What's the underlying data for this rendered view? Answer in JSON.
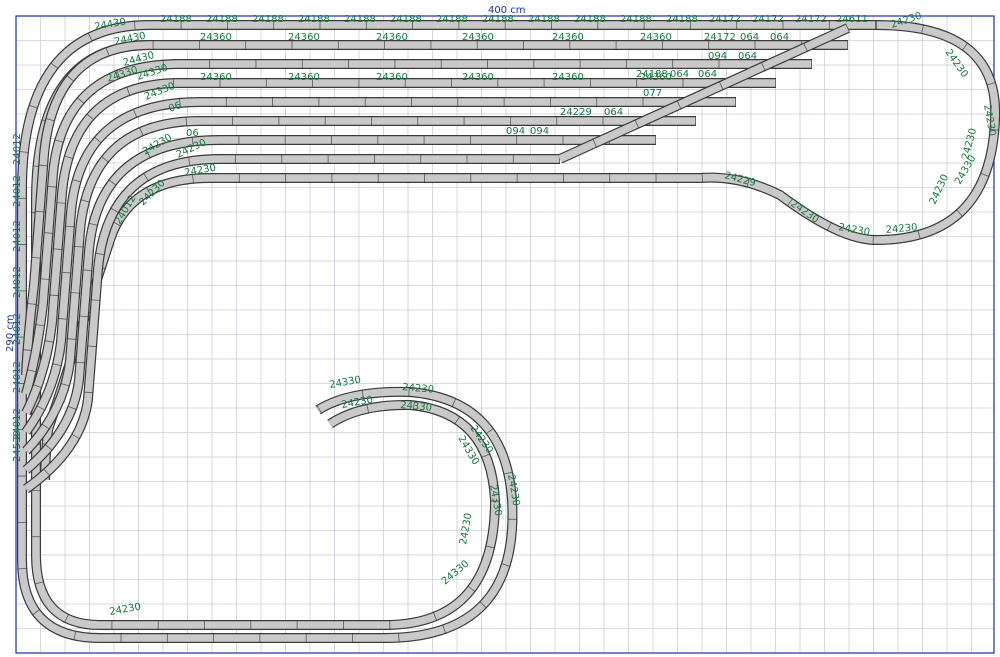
{
  "dimensions": {
    "width_label": "400 cm",
    "height_label": "290 cm"
  },
  "colors": {
    "grid": "#c8cedc",
    "board": "#1b2fb0",
    "rail_fill": "#c9c9c9",
    "rail_edge": "#3a3a3a",
    "label": "#137a3c"
  },
  "track_labels": [
    "24188",
    "24188",
    "24188",
    "24188",
    "24188",
    "24188",
    "24188",
    "24188",
    "24188",
    "24188",
    "24188",
    "24188",
    "24172",
    "24172",
    "24172",
    "24611",
    "24230",
    "24230",
    "24230",
    "24230",
    "24230",
    "24430",
    "24360",
    "24360",
    "24360",
    "24360",
    "24360",
    "24360",
    "24360",
    "24360",
    "24360",
    "24360",
    "24360",
    "24360",
    "24172",
    "064",
    "064",
    "094",
    "064",
    "24188",
    "064",
    "064",
    "077",
    "24229",
    "064",
    "094",
    "094",
    "24430",
    "24430",
    "24330",
    "24330",
    "24330",
    "06",
    "06",
    "24230",
    "24230",
    "24230",
    "24230",
    "24012",
    "24012",
    "24012",
    "24012",
    "24012",
    "24012",
    "24012",
    "24012",
    "24530",
    "24229",
    "24230",
    "24230",
    "24230",
    "24330",
    "24330",
    "24230",
    "24230",
    "24330",
    "24230",
    "24330",
    "24230",
    "24330",
    "24230",
    "24330",
    "24230"
  ]
}
